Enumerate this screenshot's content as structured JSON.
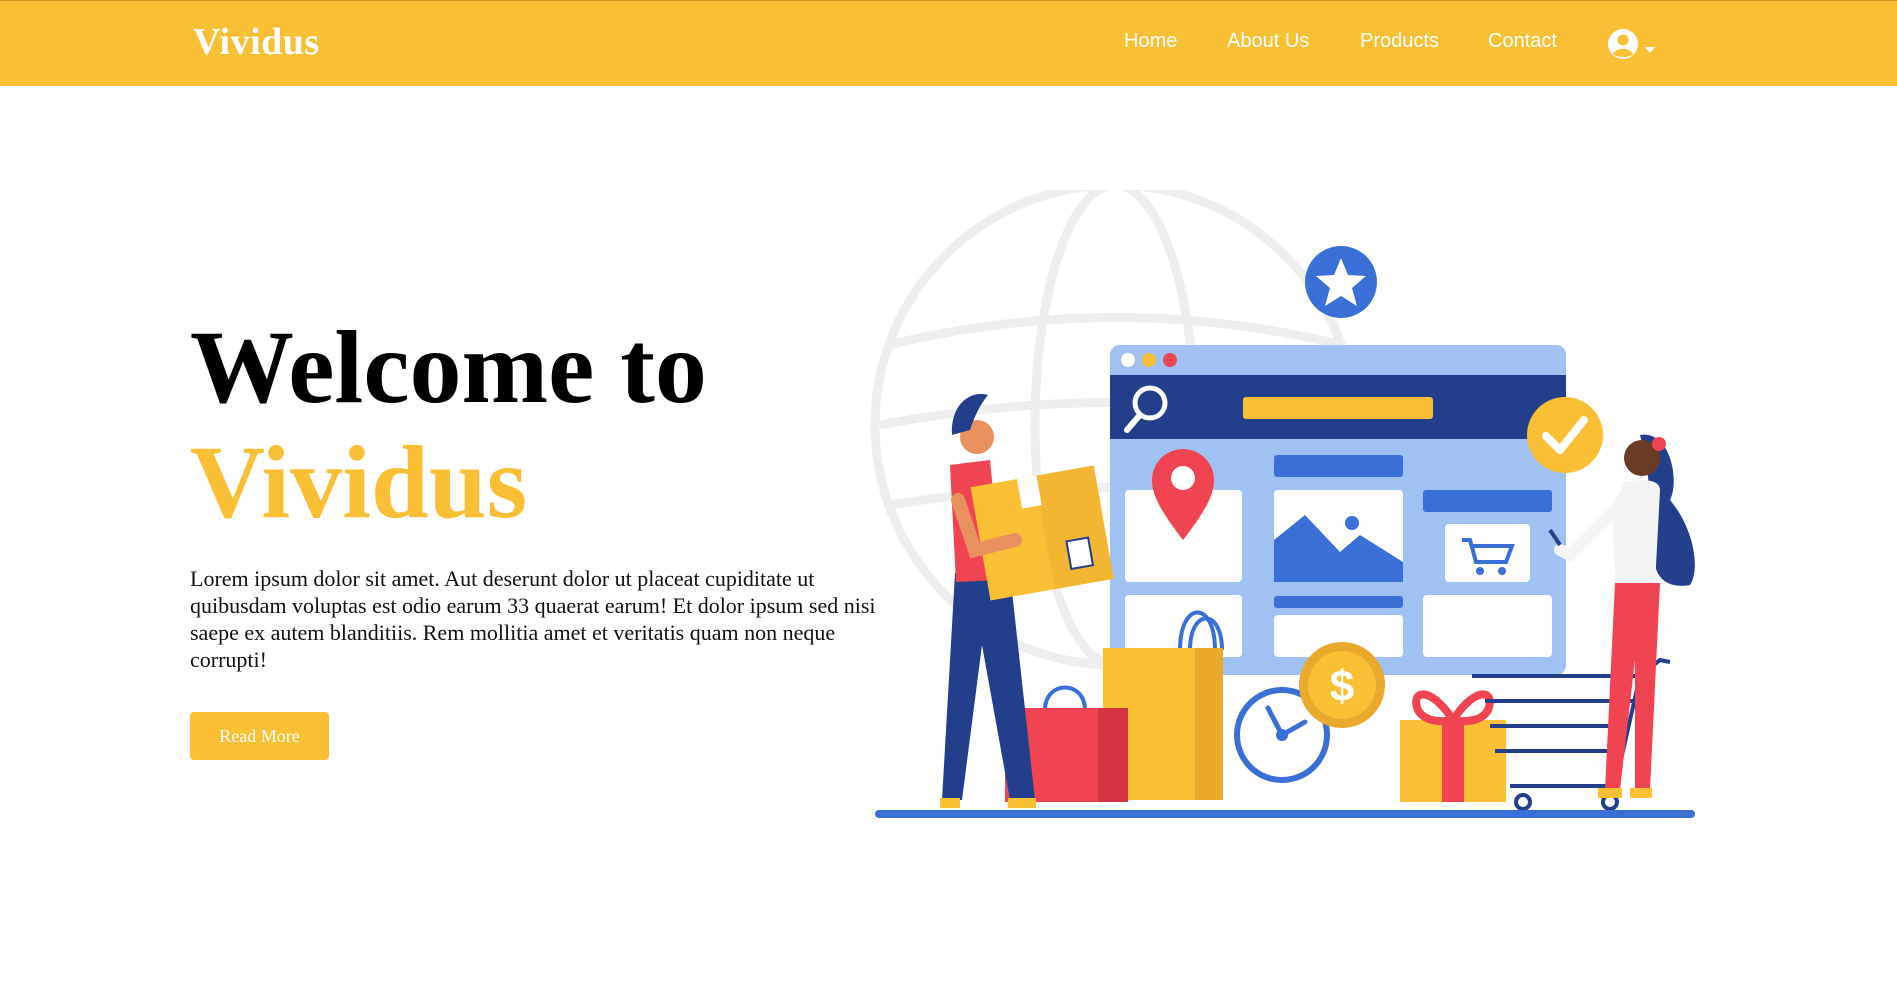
{
  "navbar": {
    "brand": "Vividus",
    "links": [
      "Home",
      "About Us",
      "Products",
      "Contact"
    ],
    "user_menu_icon": "user-circle-icon",
    "dropdown_icon": "caret-down-icon"
  },
  "hero": {
    "title_line1": "Welcome to",
    "title_line2": "Vividus",
    "body": "Lorem ipsum dolor sit amet. Aut deserunt dolor ut placeat cupiditate ut quibusdam voluptas est odio earum 33 quaerat earum! Et dolor ipsum sed nisi saepe ex autem blanditiis. Rem mollitia amet et veritatis quam non neque corrupti!",
    "cta_label": "Read More"
  },
  "colors": {
    "accent": "#fac035",
    "blue": "#3b6fd8",
    "navy": "#233f8c",
    "red": "#f04452",
    "light_blue": "#9fc2f3"
  }
}
